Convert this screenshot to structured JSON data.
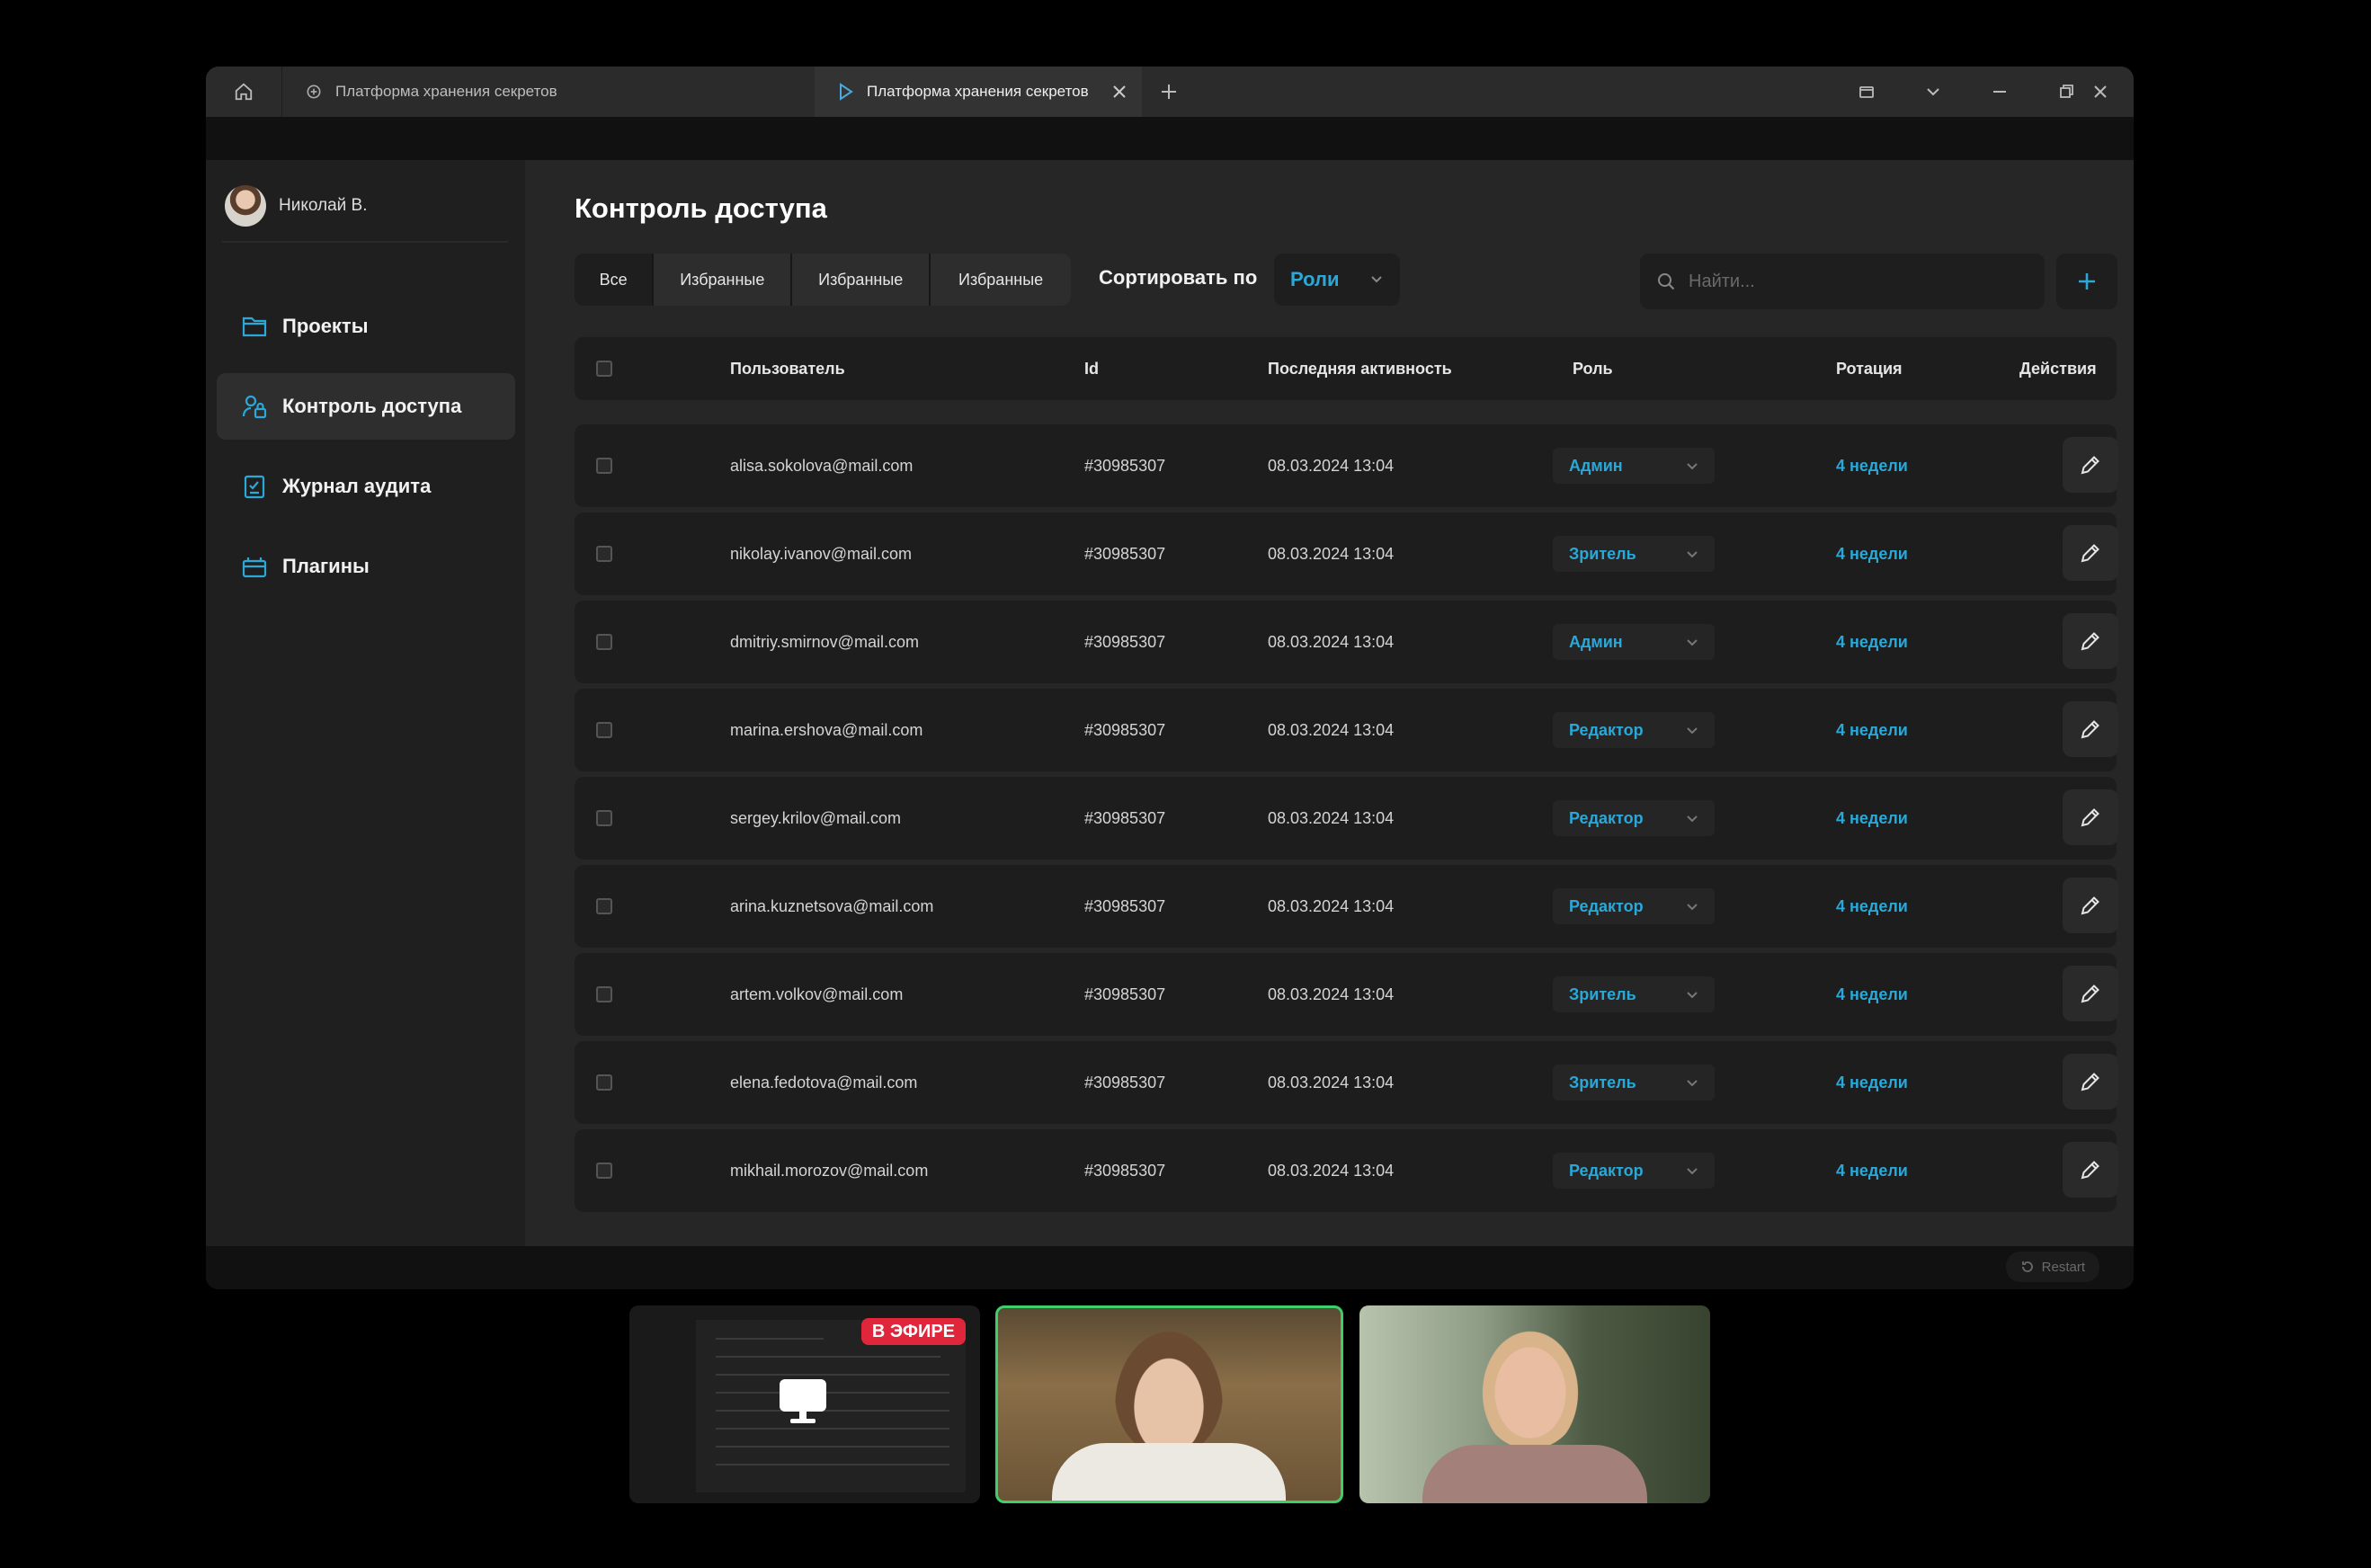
{
  "browser": {
    "tabs": [
      {
        "label": "Платформа хранения секретов",
        "active": false
      },
      {
        "label": "Платформа хранения секретов",
        "active": true
      }
    ]
  },
  "sidebar": {
    "user_name": "Николай В.",
    "items": [
      {
        "label": "Проекты",
        "icon": "folder-icon",
        "active": false
      },
      {
        "label": "Контроль доступа",
        "icon": "user-lock-icon",
        "active": true
      },
      {
        "label": "Журнал аудита",
        "icon": "audit-log-icon",
        "active": false
      },
      {
        "label": "Плагины",
        "icon": "plugin-icon",
        "active": false
      }
    ]
  },
  "main": {
    "title": "Контроль доступа",
    "filters": [
      "Все",
      "Избранные",
      "Избранные",
      "Избранные"
    ],
    "sort_label": "Сортировать по",
    "sort_value": "Роли",
    "search_placeholder": "Найти...",
    "columns": {
      "user": "Пользователь",
      "id": "Id",
      "last_activity": "Последняя активность",
      "role": "Роль",
      "rotation": "Ротация",
      "actions": "Действия"
    },
    "rows": [
      {
        "email": "alisa.sokolova@mail.com",
        "id": "#30985307",
        "activity": "08.03.2024 13:04",
        "role": "Админ",
        "rotation": "4 недели"
      },
      {
        "email": "nikolay.ivanov@mail.com",
        "id": "#30985307",
        "activity": "08.03.2024 13:04",
        "role": "Зритель",
        "rotation": "4 недели"
      },
      {
        "email": "dmitriy.smirnov@mail.com",
        "id": "#30985307",
        "activity": "08.03.2024 13:04",
        "role": "Админ",
        "rotation": "4 недели"
      },
      {
        "email": "marina.ershova@mail.com",
        "id": "#30985307",
        "activity": "08.03.2024 13:04",
        "role": "Редактор",
        "rotation": "4 недели"
      },
      {
        "email": "sergey.krilov@mail.com",
        "id": "#30985307",
        "activity": "08.03.2024 13:04",
        "role": "Редактор",
        "rotation": "4 недели"
      },
      {
        "email": "arina.kuznetsova@mail.com",
        "id": "#30985307",
        "activity": "08.03.2024 13:04",
        "role": "Редактор",
        "rotation": "4 недели"
      },
      {
        "email": "artem.volkov@mail.com",
        "id": "#30985307",
        "activity": "08.03.2024 13:04",
        "role": "Зритель",
        "rotation": "4 недели"
      },
      {
        "email": "elena.fedotova@mail.com",
        "id": "#30985307",
        "activity": "08.03.2024 13:04",
        "role": "Зритель",
        "rotation": "4 недели"
      },
      {
        "email": "mikhail.morozov@mail.com",
        "id": "#30985307",
        "activity": "08.03.2024 13:04",
        "role": "Редактор",
        "rotation": "4 недели"
      }
    ]
  },
  "footer": {
    "restart_label": "Restart"
  },
  "call": {
    "live_badge": "В ЭФИРЕ",
    "active_speaker_color": "#3ecf6a"
  },
  "colors": {
    "accent": "#2aa8d8",
    "live": "#e0263a",
    "background": "#000000",
    "panel": "#1d1d1d"
  }
}
